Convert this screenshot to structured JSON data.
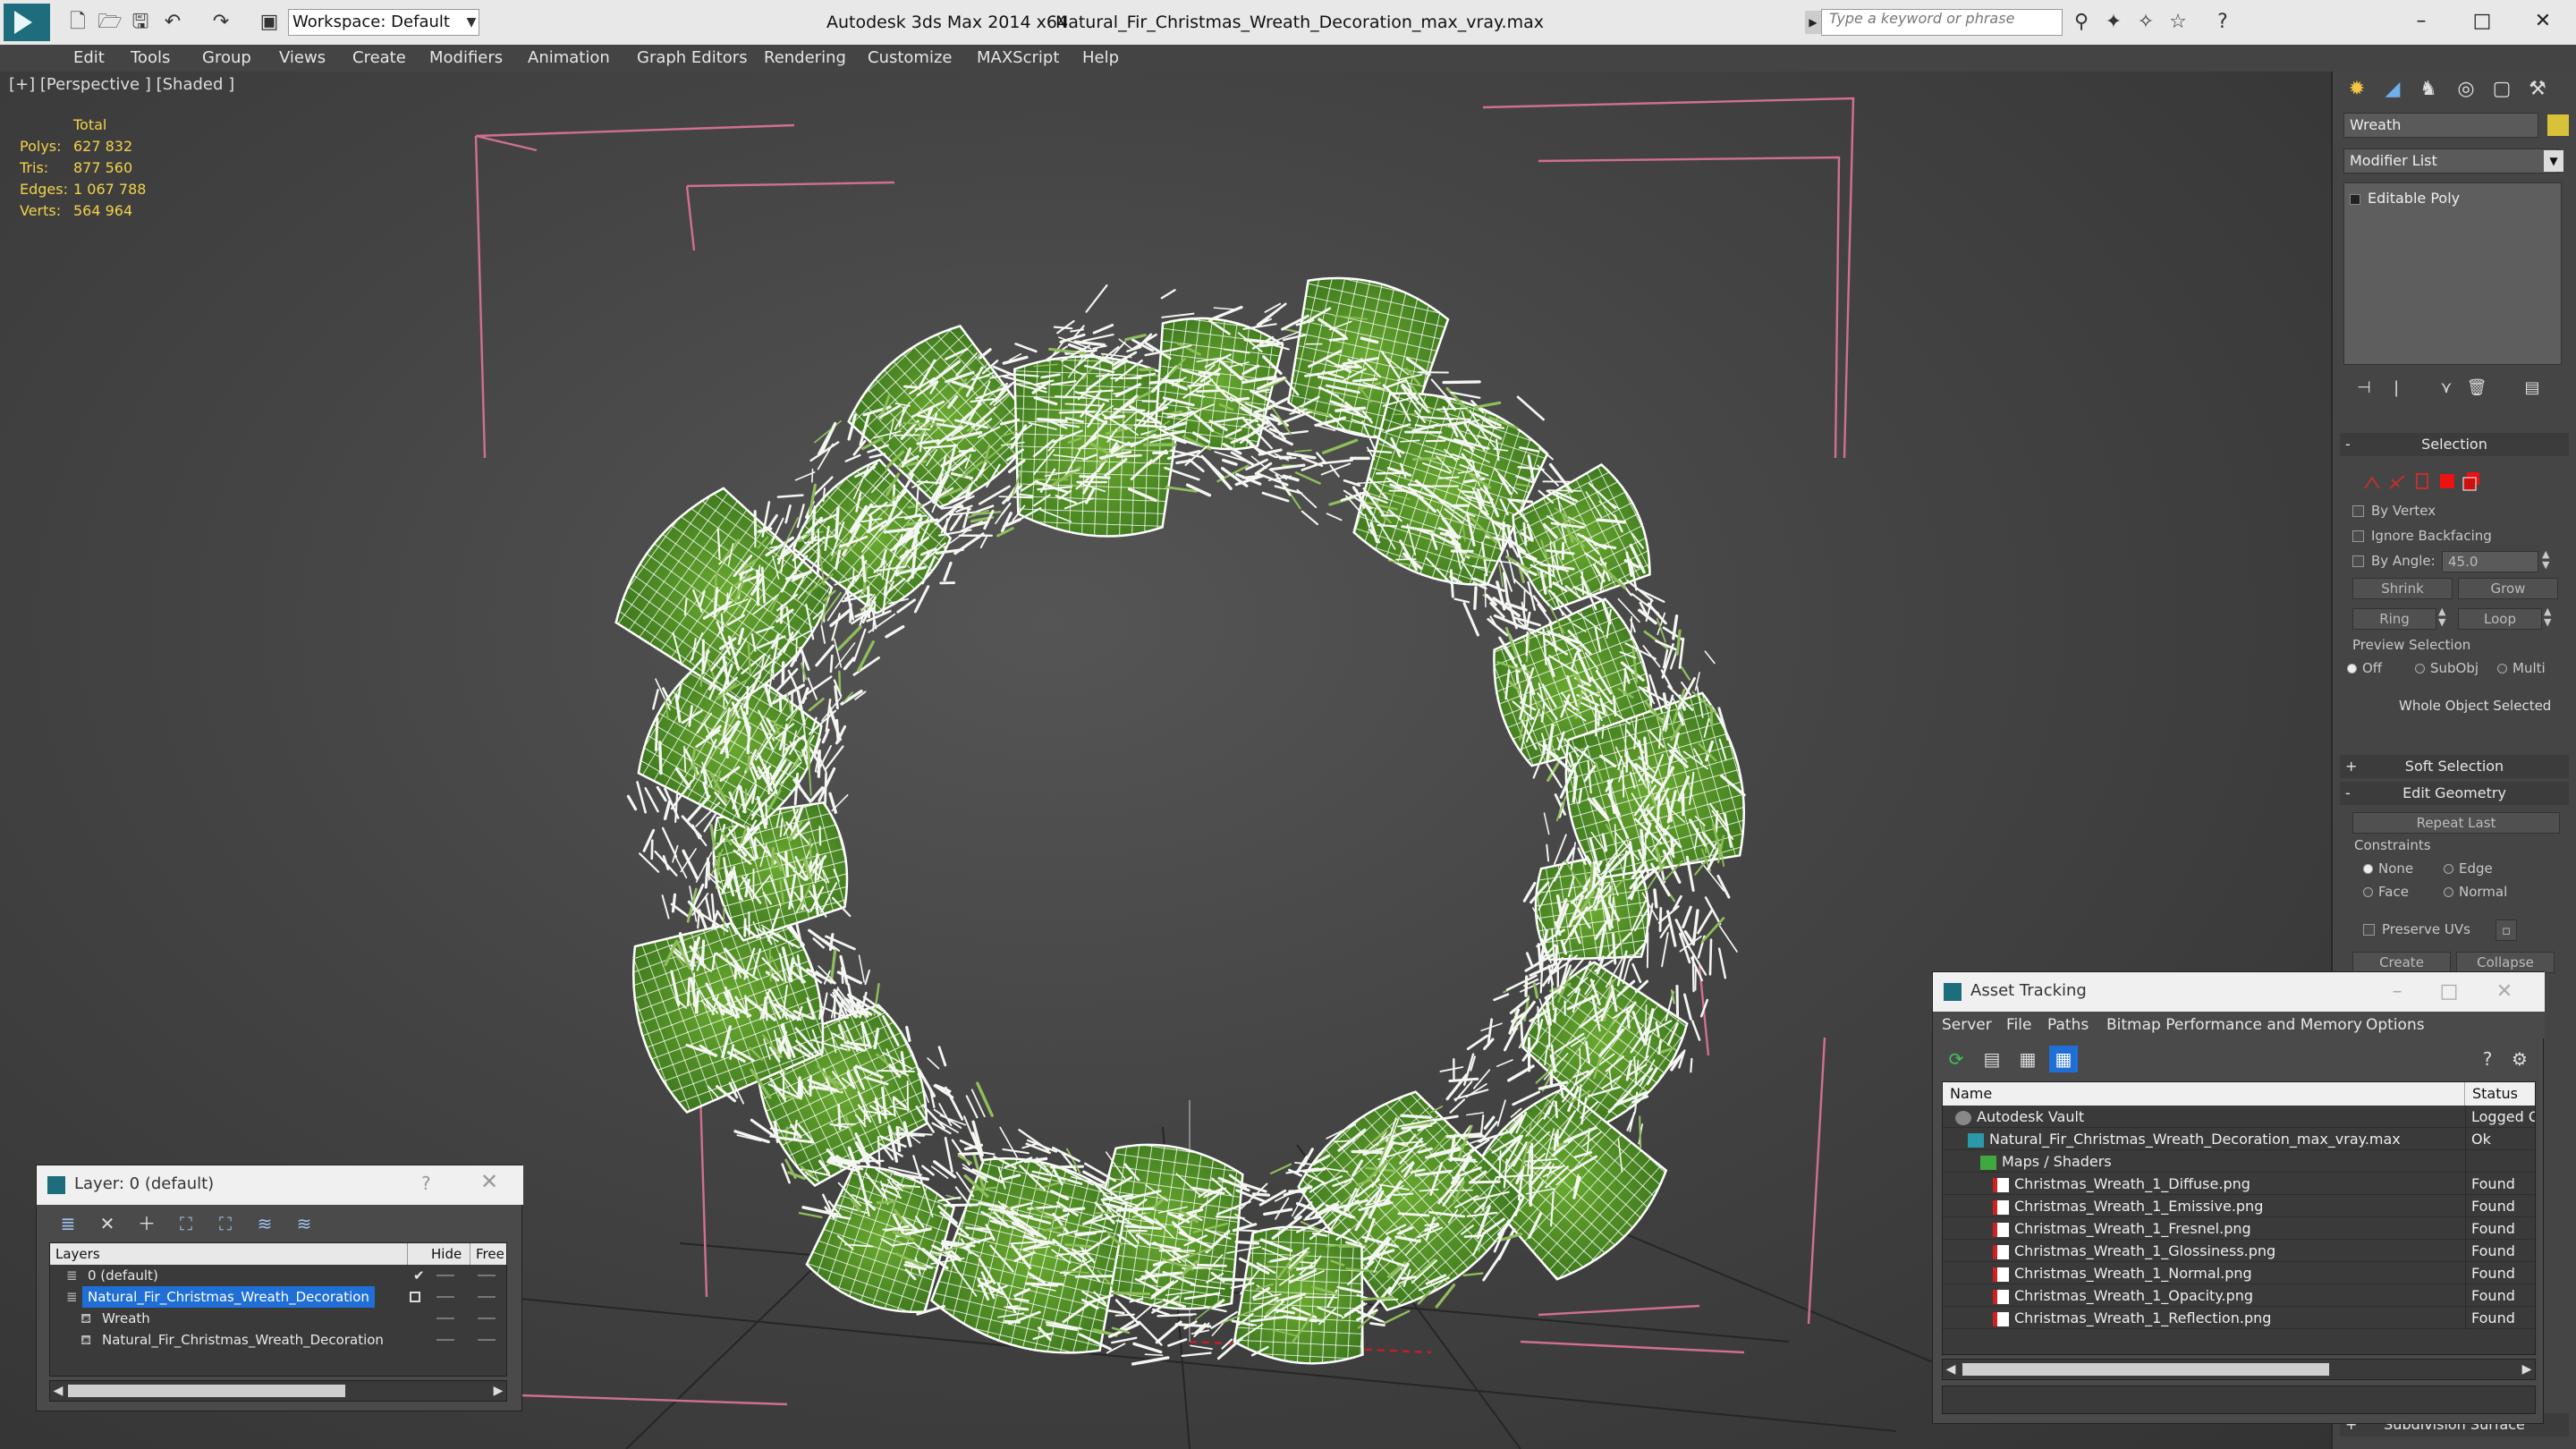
{
  "titlebar": {
    "workspace": "Workspace: Default",
    "app_title": "Autodesk 3ds Max 2014 x64",
    "file_title": "Natural_Fir_Christmas_Wreath_Decoration_max_vray.max",
    "search_placeholder": "Type a keyword or phrase"
  },
  "menu": [
    "Edit",
    "Tools",
    "Group",
    "Views",
    "Create",
    "Modifiers",
    "Animation",
    "Graph Editors",
    "Rendering",
    "Customize",
    "MAXScript",
    "Help"
  ],
  "viewport": {
    "label": "[+] [Perspective ] [Shaded ]",
    "stats_header": "Total",
    "stats": [
      {
        "label": "Polys:",
        "value": "627 832"
      },
      {
        "label": "Tris:",
        "value": "877 560"
      },
      {
        "label": "Edges:",
        "value": "1 067 788"
      },
      {
        "label": "Verts:",
        "value": "564 964"
      }
    ]
  },
  "command_panel": {
    "object_name": "Wreath",
    "object_color": "#d8c23a",
    "modifier_list": "Modifier List",
    "stack_item": "Editable Poly",
    "selection": {
      "title": "Selection",
      "by_vertex": "By Vertex",
      "ignore_backfacing": "Ignore Backfacing",
      "by_angle": "By Angle:",
      "angle_value": "45.0",
      "shrink": "Shrink",
      "grow": "Grow",
      "ring": "Ring",
      "loop": "Loop",
      "preview_selection": "Preview Selection",
      "preview_off": "Off",
      "preview_subobj": "SubObj",
      "preview_multi": "Multi",
      "whole_object": "Whole Object Selected"
    },
    "soft_selection": "Soft Selection",
    "edit_geometry": {
      "title": "Edit Geometry",
      "repeat_last": "Repeat Last",
      "constraints": "Constraints",
      "none": "None",
      "edge": "Edge",
      "face": "Face",
      "normal": "Normal",
      "preserve_uvs": "Preserve UVs",
      "create": "Create",
      "collapse": "Collapse"
    },
    "subdivision_surface": "Subdivision Surface"
  },
  "layer_window": {
    "title": "Layer: 0 (default)",
    "help": "?",
    "columns": [
      "Layers",
      "Hide",
      "Free"
    ],
    "rows": [
      {
        "name": "0 (default)",
        "indent": 1,
        "selected": false,
        "check": "✔"
      },
      {
        "name": "Natural_Fir_Christmas_Wreath_Decoration",
        "indent": 1,
        "selected": true,
        "check": ""
      },
      {
        "name": "Wreath",
        "indent": 2,
        "selected": false,
        "check": ""
      },
      {
        "name": "Natural_Fir_Christmas_Wreath_Decoration",
        "indent": 2,
        "selected": false,
        "check": ""
      }
    ]
  },
  "asset_window": {
    "title": "Asset Tracking",
    "menu": [
      "Server",
      "File",
      "Paths",
      "Bitmap Performance and Memory",
      "Options"
    ],
    "columns": [
      "Name",
      "Status"
    ],
    "rows": [
      {
        "name": "Autodesk Vault",
        "status": "Logged Ou",
        "indent": 1,
        "kind": "vault"
      },
      {
        "name": "Natural_Fir_Christmas_Wreath_Decoration_max_vray.max",
        "status": "Ok",
        "indent": 2,
        "kind": "max"
      },
      {
        "name": "Maps / Shaders",
        "status": "",
        "indent": 3,
        "kind": "maps"
      },
      {
        "name": "Christmas_Wreath_1_Diffuse.png",
        "status": "Found",
        "indent": 4,
        "kind": "png"
      },
      {
        "name": "Christmas_Wreath_1_Emissive.png",
        "status": "Found",
        "indent": 4,
        "kind": "png"
      },
      {
        "name": "Christmas_Wreath_1_Fresnel.png",
        "status": "Found",
        "indent": 4,
        "kind": "png"
      },
      {
        "name": "Christmas_Wreath_1_Glossiness.png",
        "status": "Found",
        "indent": 4,
        "kind": "png"
      },
      {
        "name": "Christmas_Wreath_1_Normal.png",
        "status": "Found",
        "indent": 4,
        "kind": "png"
      },
      {
        "name": "Christmas_Wreath_1_Opacity.png",
        "status": "Found",
        "indent": 4,
        "kind": "png"
      },
      {
        "name": "Christmas_Wreath_1_Reflection.png",
        "status": "Found",
        "indent": 4,
        "kind": "png"
      }
    ]
  },
  "colors": {
    "selection_blue": "#1f6fd6",
    "stats_yellow": "#f2d24a",
    "bbox_pink": "#d07090",
    "foliage_green": "#5a9a2a"
  }
}
